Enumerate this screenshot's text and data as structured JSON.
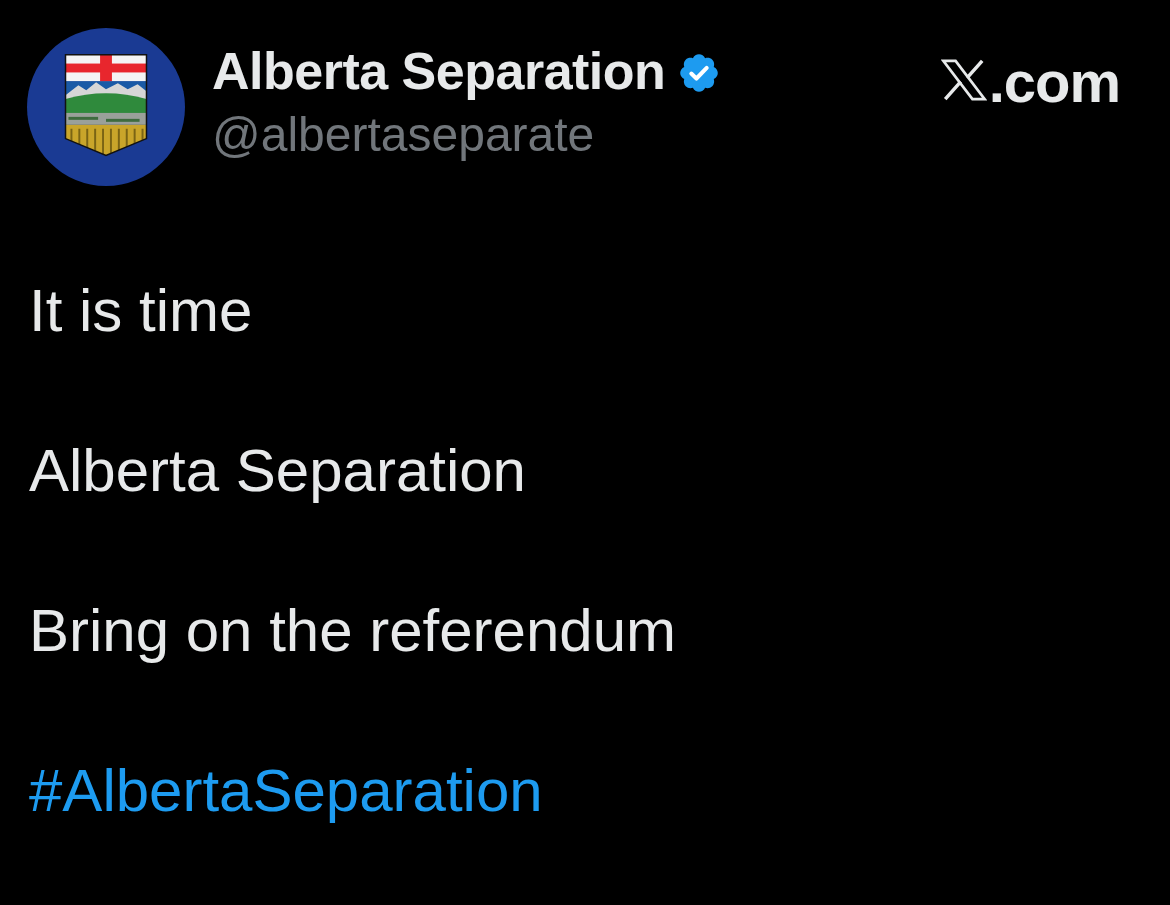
{
  "account": {
    "name": "Alberta Separation",
    "verified": true,
    "handle": "@albertaseparate"
  },
  "source": {
    "label": ".com"
  },
  "post": {
    "paragraphs": [
      {
        "kind": "text",
        "text": "It is time"
      },
      {
        "kind": "text",
        "text": "Alberta Separation"
      },
      {
        "kind": "text",
        "text": "Bring on the referendum"
      },
      {
        "kind": "hashtag",
        "text": "#AlbertaSeparation"
      }
    ]
  }
}
